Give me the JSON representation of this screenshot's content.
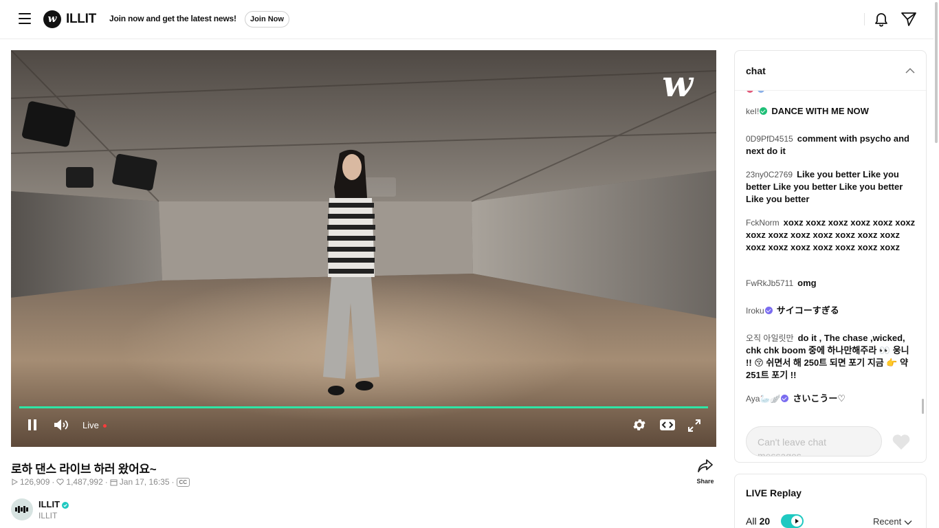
{
  "header": {
    "logo_letter": "w",
    "artist_name": "ILLIT",
    "promo_text": "Join now and get the latest news!",
    "join_label": "Join Now"
  },
  "video": {
    "watermark": "w",
    "live_label": "Live",
    "progress": 1.0,
    "accent_color": "#2ee6a6",
    "title": "로하 댄스 라이브 하러 왔어요~",
    "views": "126,909",
    "likes": "1,487,992",
    "date": "Jan 17, 16:35",
    "cc_label": "CC",
    "share_label": "Share"
  },
  "channel": {
    "name": "ILLIT",
    "sub": "ILLIT"
  },
  "chat": {
    "title": "chat",
    "messages": [
      {
        "nick": "keI!",
        "text": "DANCE WITH ME NOW",
        "badge": "#1fbf77"
      },
      {
        "nick": "0D9PfD4515",
        "text": "comment with psycho and next do it"
      },
      {
        "nick": "23ny0C2769",
        "text": "Like you better Like you better Like you better Like you better Like you better"
      },
      {
        "nick": "FckNorm",
        "text": "xoxz xoxz xoxz xoxz xoxz xoxz xoxz xoxz xoxz xoxz xoxz xoxz xoxz xoxz xoxz xoxz xoxz xoxz xoxz xoxz"
      },
      {
        "nick": "FwRkJb5711",
        "text": "omg"
      },
      {
        "nick": "Iroku",
        "text": "サイコーすぎる",
        "badge": "#7a6cf0"
      },
      {
        "nick": "오직 아일릿만",
        "text": "do it , The chase ,wicked, chk chk boom 중에 하나만해주라 👀 웅니 !! 😚 쉬면서 해 250트 되면 포기 지금 👉 약 251트 포기 !!"
      },
      {
        "nick": "Aya🦢🪽",
        "text": "さいこうー♡",
        "badge": "#7a6cf0"
      }
    ],
    "input_placeholder": "Can't leave chat messages"
  },
  "replay": {
    "title": "LIVE Replay",
    "all_label": "All",
    "count": "20",
    "sort_label": "Recent"
  }
}
